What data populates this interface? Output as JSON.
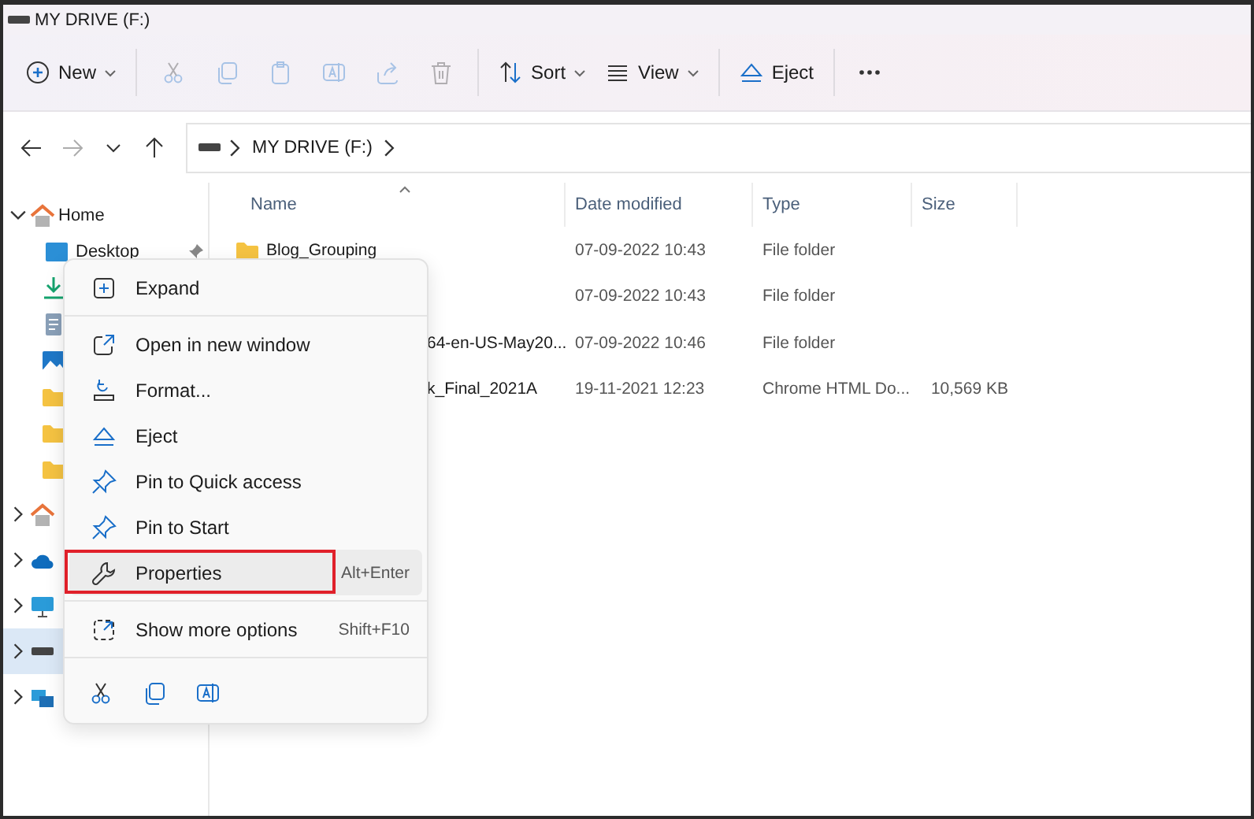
{
  "window": {
    "title": "MY DRIVE (F:)"
  },
  "toolbar": [
    {
      "label": "New",
      "caret": true,
      "disabled": false
    },
    {
      "disabled": true
    },
    {
      "disabled": true
    },
    {
      "disabled": true
    },
    {
      "disabled": true
    },
    {
      "disabled": true
    },
    {
      "disabled": true
    },
    {
      "label": "Sort",
      "caret": true,
      "disabled": false
    },
    {
      "label": "View",
      "caret": true,
      "disabled": false
    },
    {
      "label": "Eject",
      "caret": false,
      "disabled": false
    },
    {
      "disabled": false
    }
  ],
  "navigation": [
    {
      "disabled": false
    },
    {
      "disabled": true
    },
    {
      "disabled": false
    },
    {
      "disabled": false
    }
  ],
  "address": {
    "path": [
      "MY DRIVE (F:)"
    ]
  },
  "sidebar": {
    "items": [
      {
        "label": "Home",
        "expanded": true,
        "selected": false,
        "children": [
          {
            "label": "Desktop",
            "pinned": true,
            "selected": false
          },
          {
            "selected": false
          },
          {
            "selected": false
          },
          {
            "selected": false
          },
          {
            "selected": false
          },
          {
            "selected": false
          },
          {
            "selected": false
          }
        ]
      },
      {
        "expanded": false,
        "selected": false
      },
      {
        "expanded": false,
        "selected": false
      },
      {
        "expanded": false,
        "selected": false
      },
      {
        "expanded": false,
        "selected": true
      },
      {
        "expanded": false,
        "selected": false
      }
    ]
  },
  "table": {
    "columns": [
      {
        "label": "Name",
        "sorted": true
      },
      {
        "label": "Date modified"
      },
      {
        "label": "Type"
      },
      {
        "label": "Size"
      }
    ],
    "rows": [
      {
        "kind": "folder",
        "name": "Blog_Grouping",
        "date": "07-09-2022 10:43",
        "type": "File folder"
      },
      {
        "date": "07-09-2022 10:43",
        "type": "File folder"
      },
      {
        "name": "64-en-US-May20...",
        "date": "07-09-2022 10:46",
        "type": "File folder"
      },
      {
        "name": "k_Final_2021A",
        "date": "19-11-2021 12:23",
        "type": "Chrome HTML Do...",
        "size": "10,569 KB"
      }
    ]
  },
  "context_menu": {
    "items": [
      {
        "kind": "item",
        "label": "Expand",
        "selected": false,
        "outlined": false
      },
      {
        "kind": "separator"
      },
      {
        "kind": "item",
        "label": "Open in new window",
        "selected": false,
        "outlined": false
      },
      {
        "kind": "item",
        "label": "Format...",
        "selected": false,
        "outlined": false
      },
      {
        "kind": "item",
        "label": "Eject",
        "selected": false,
        "outlined": false
      },
      {
        "kind": "item",
        "label": "Pin to Quick access",
        "selected": false,
        "outlined": false
      },
      {
        "kind": "item",
        "label": "Pin to Start",
        "selected": false,
        "outlined": false
      },
      {
        "kind": "item",
        "label": "Properties",
        "shortcut": "Alt+Enter",
        "selected": true,
        "outlined": true
      },
      {
        "kind": "separator"
      },
      {
        "kind": "item",
        "label": "Show more options",
        "shortcut": "Shift+F10",
        "selected": false,
        "outlined": false
      },
      {
        "kind": "separator"
      },
      {
        "kind": "icon_row"
      }
    ]
  }
}
